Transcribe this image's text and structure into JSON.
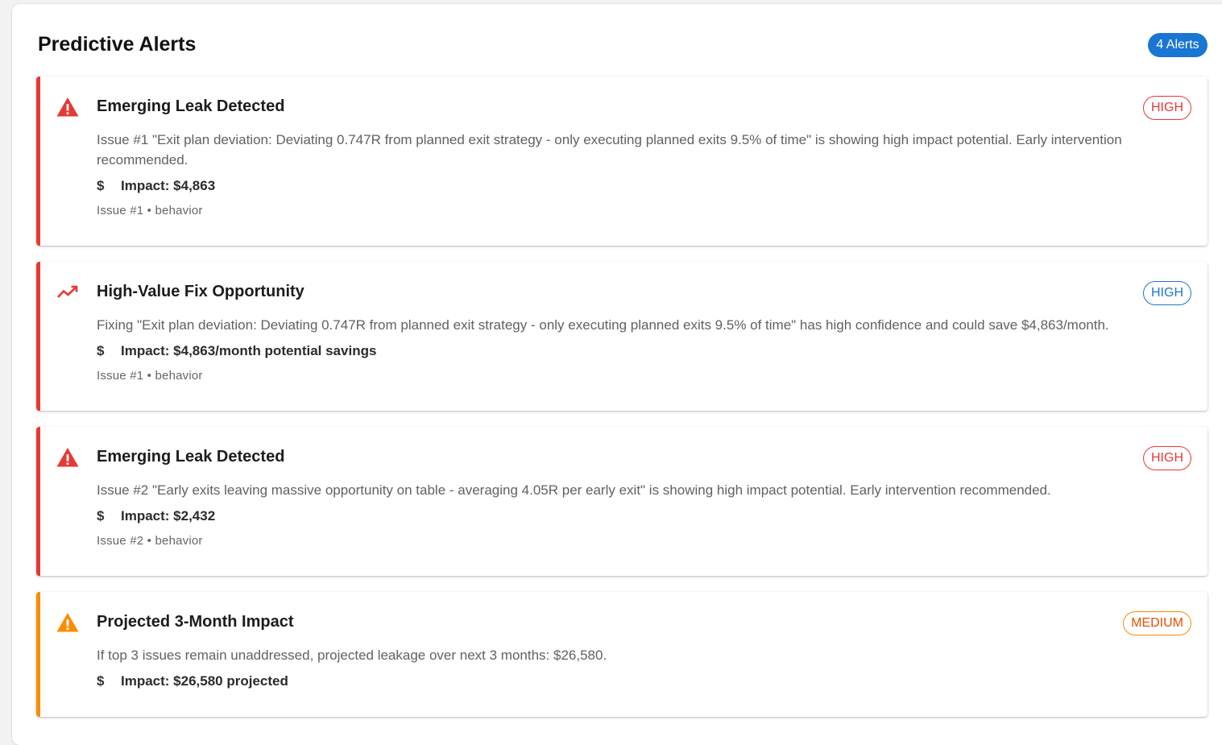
{
  "header": {
    "title": "Predictive Alerts",
    "count_label": "4 Alerts"
  },
  "colors": {
    "high": "#e53935",
    "high_blue": "#1976d2",
    "medium": "#fb8c00",
    "badge": "#1976d2"
  },
  "alerts": [
    {
      "icon": "warning-triangle-icon",
      "title": "Emerging Leak Detected",
      "severity": "HIGH",
      "description": "Issue #1 \"Exit plan deviation: Deviating 0.747R from planned exit strategy - only executing planned exits 9.5% of time\" is showing high impact potential. Early intervention recommended.",
      "impact": "Impact: $4,863",
      "meta": "Issue #1 • behavior"
    },
    {
      "icon": "trending-up-icon",
      "title": "High-Value Fix Opportunity",
      "severity": "HIGH",
      "description": "Fixing \"Exit plan deviation: Deviating 0.747R from planned exit strategy - only executing planned exits 9.5% of time\" has high confidence and could save $4,863/month.",
      "impact": "Impact: $4,863/month potential savings",
      "meta": "Issue #1 • behavior"
    },
    {
      "icon": "warning-triangle-icon",
      "title": "Emerging Leak Detected",
      "severity": "HIGH",
      "description": "Issue #2 \"Early exits leaving massive opportunity on table - averaging 4.05R per early exit\" is showing high impact potential. Early intervention recommended.",
      "impact": "Impact: $2,432",
      "meta": "Issue #2 • behavior"
    },
    {
      "icon": "warning-triangle-icon",
      "title": "Projected 3-Month Impact",
      "severity": "MEDIUM",
      "description": "If top 3 issues remain unaddressed, projected leakage over next 3 months: $26,580.",
      "impact": "Impact: $26,580 projected"
    }
  ]
}
